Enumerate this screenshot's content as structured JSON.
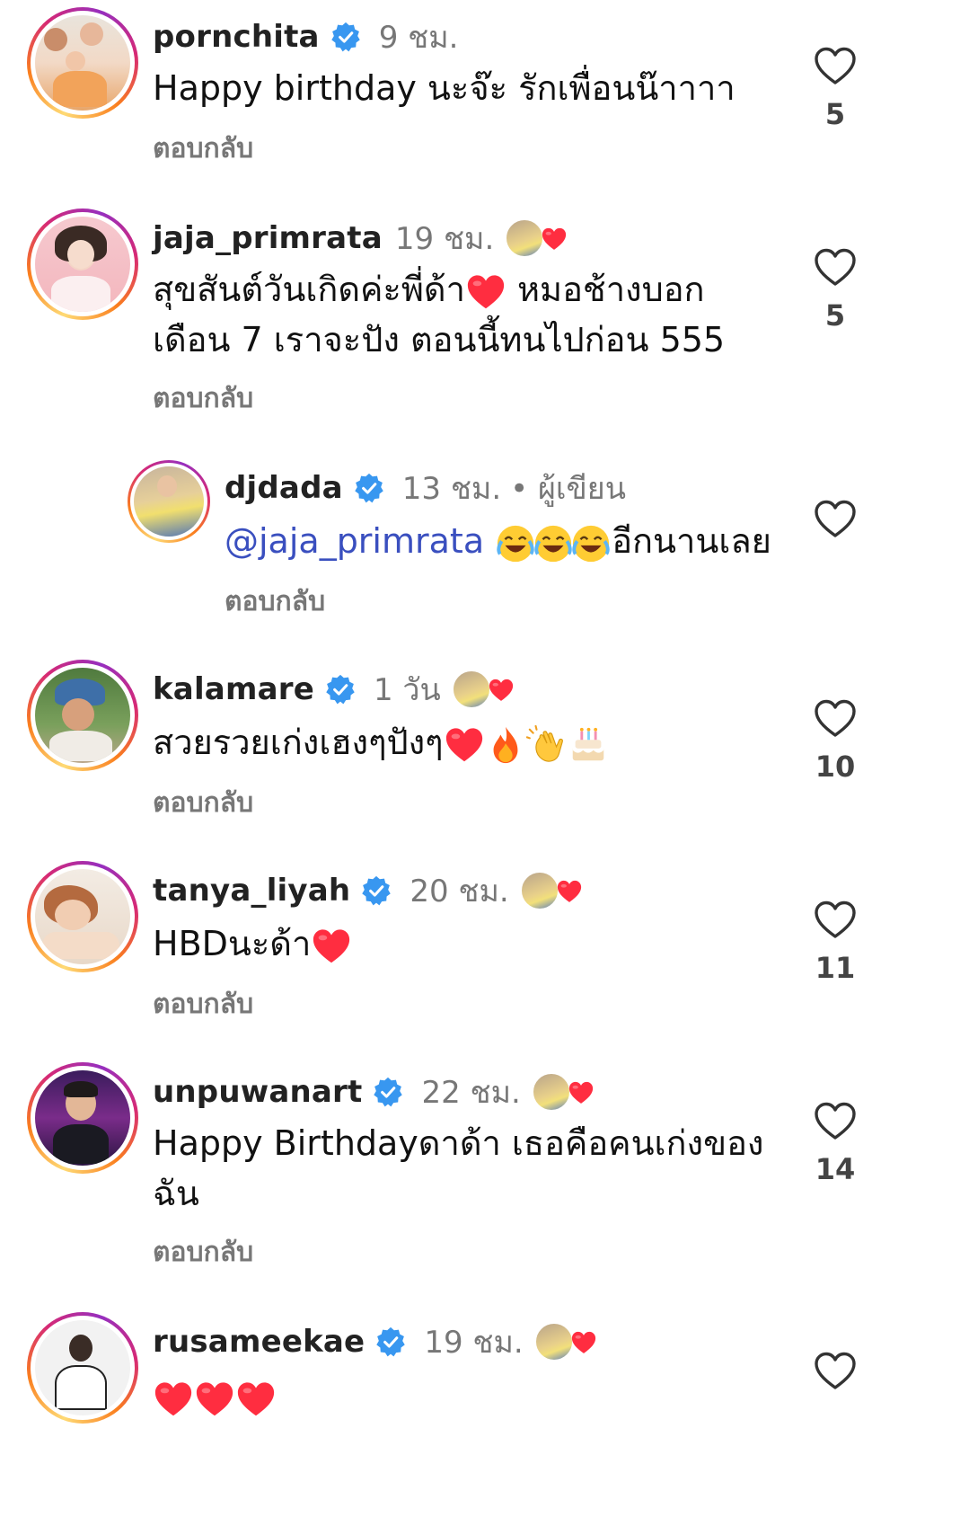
{
  "comments": [
    {
      "username": "pornchita",
      "verified": true,
      "time": "9 ชม.",
      "text": "Happy birthday นะจ๊ะ รักเพื่อนน๊าาาา",
      "reply": "ตอบกลับ",
      "likes": "5",
      "liked_by_author": false
    },
    {
      "username": "jaja_primrata",
      "verified": false,
      "time": "19 ชม.",
      "text_line1": "สุขสันต์วันเกิดค่ะพี่ด้า",
      "text_line1b": " หมอช้างบอก",
      "text_line2": "เดือน 7 เราจะปัง ตอนนี้ทนไปก่อน 555",
      "reply": "ตอบกลับ",
      "likes": "5",
      "liked_by_author": true
    },
    {
      "username": "djdada",
      "verified": true,
      "time": "13 ชม.",
      "author_tag": "• ผู้เขียน",
      "mention": "@jaja_primrata",
      "text_after": "อีกนานเลย",
      "reply": "ตอบกลับ",
      "likes": ""
    },
    {
      "username": "kalamare",
      "verified": true,
      "time": "1 วัน",
      "text": "สวยรวยเก่งเฮงๆปังๆ",
      "reply": "ตอบกลับ",
      "likes": "10",
      "liked_by_author": true
    },
    {
      "username": "tanya_liyah",
      "verified": true,
      "time": "20 ชม.",
      "text": "HBDนะด้า",
      "reply": "ตอบกลับ",
      "likes": "11",
      "liked_by_author": true
    },
    {
      "username": "unpuwanart",
      "verified": true,
      "time": "22 ชม.",
      "text_line1": "Happy Birthdayดาด้า เธอคือคนเก่งของ",
      "text_line2": "ฉัน",
      "reply": "ตอบกลับ",
      "likes": "14",
      "liked_by_author": true
    },
    {
      "username": "rusameekae",
      "verified": true,
      "time": "19 ชม.",
      "likes": "",
      "liked_by_author": true
    }
  ],
  "colors": {
    "verified": "#3897f0",
    "heart_red": "#ff2d40",
    "mention": "#3a4fbf"
  }
}
